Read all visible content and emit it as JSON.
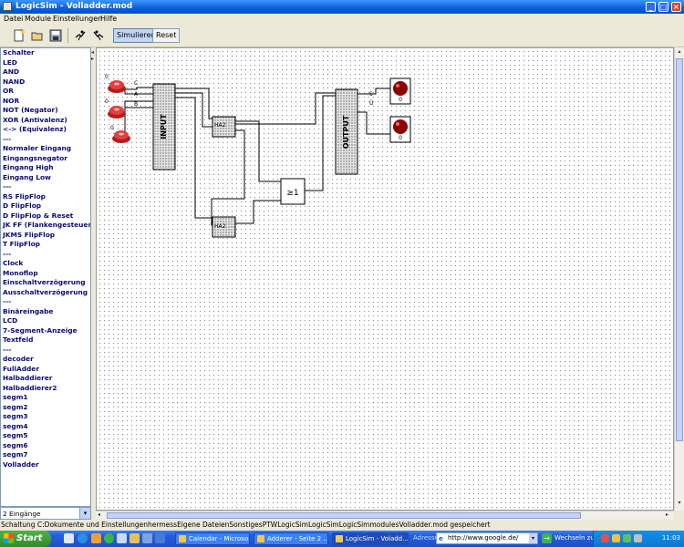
{
  "window": {
    "title": "LogicSim - Volladder.mod"
  },
  "menu": [
    "Datei",
    "Module",
    "Einstellungen",
    "Hilfe"
  ],
  "toolbar": {
    "simulate": "Simulieren",
    "reset": "Reset"
  },
  "sidebar": {
    "items": [
      "Schalter",
      "LED",
      "AND",
      "NAND",
      "OR",
      "NOR",
      "NOT (Negator)",
      "XOR (Antivalenz)",
      "<-> (Equivalenz)",
      "---",
      "Normaler Eingang",
      "Eingangsnegator",
      "Eingang High",
      "Eingang Low",
      "---",
      "RS FlipFlop",
      "D FlipFlop",
      "D FlipFlop & Reset",
      "JK FF (Flankengesteuert)",
      "JKMS FlipFlop",
      "T FlipFlop",
      "---",
      "Clock",
      "Monoflop",
      "Einschaltverzögerung",
      "Ausschaltverzögerung",
      "---",
      "Binäreingabe",
      "LCD",
      "7-Segment-Anzeige",
      "Textfeld",
      "---",
      "decoder",
      "FullAdder",
      "Halbaddierer",
      "Halbaddierer2",
      "segm1",
      "segm2",
      "segm3",
      "segm4",
      "segm5",
      "segm6",
      "segm7",
      "Volladder"
    ],
    "selector": "2 Eingänge"
  },
  "circuit": {
    "switches": [
      {
        "state": "0"
      },
      {
        "state": "0"
      },
      {
        "state": "0"
      }
    ],
    "input_pins": [
      "C",
      "A",
      "B"
    ],
    "input_block": "INPUT",
    "output_block": "OUTPUT",
    "output_pins": [
      "S",
      "Ü"
    ],
    "ha_blocks": [
      "HA2",
      "HA2"
    ],
    "or_gate": "≥1",
    "leds": [
      {
        "value": "0"
      },
      {
        "value": "0"
      }
    ]
  },
  "status": "Schaltung C:Dokumente und EinstellungenhermessEigene DateienSonstigesPTWLogicSimLogicSimLogicSimmodulesVolladder.mod gespeichert",
  "taskbar": {
    "start": "Start",
    "tasks": [
      "Calendar - Microso...",
      "Adderer - Seite 2 ...",
      "LogicSim - Voladd..."
    ],
    "address_label": "Adresse",
    "address": "http://www.google.de/",
    "go_label": "Wechseln zu",
    "clock": "11:03"
  }
}
